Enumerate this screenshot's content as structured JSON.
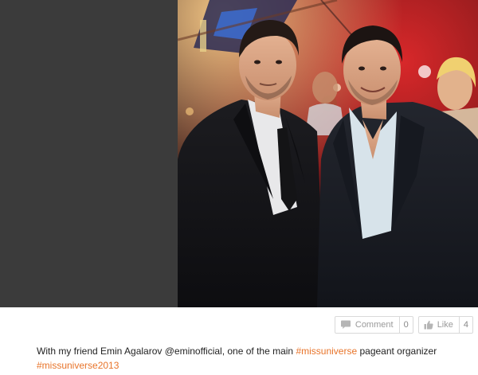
{
  "post": {
    "caption": {
      "text_before": "With my friend Emin Agalarov @eminofficial, one of the main ",
      "hashtag_1": "#missuniverse",
      "text_middle": " pageant organizer ",
      "hashtag_2": "#missuniverse2013"
    },
    "actions": {
      "comment_label": "Comment",
      "comment_count": "0",
      "like_label": "Like",
      "like_count": "4"
    }
  },
  "colors": {
    "hashtag": "#e8742a",
    "media_background": "#3b3b3b",
    "button_text": "#9a9a9a"
  },
  "icons": {
    "comment": "speech-bubble-icon",
    "like": "thumbs-up-icon"
  }
}
